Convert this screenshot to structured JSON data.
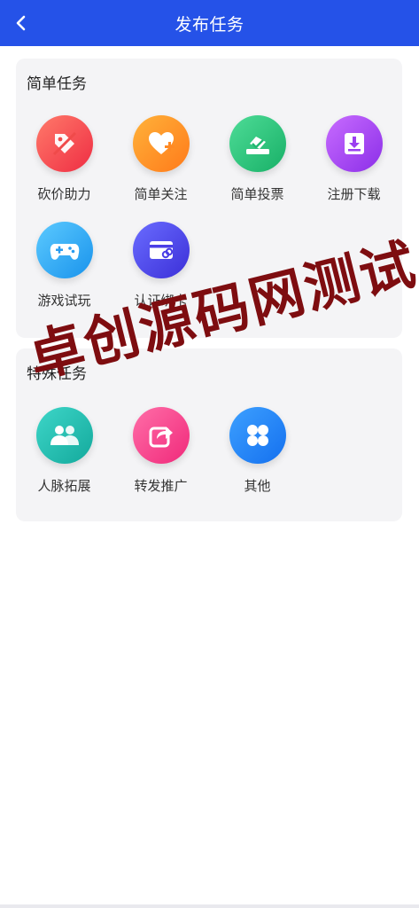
{
  "header": {
    "title": "发布任务",
    "back_icon": "chevron-left-icon",
    "background": "#2552e8"
  },
  "sections": [
    {
      "title": "简单任务",
      "items": [
        {
          "label": "砍价助力",
          "icon": "price-tag-slash-icon",
          "color_from": "#ff7a6a",
          "color_to": "#ef2d43"
        },
        {
          "label": "简单关注",
          "icon": "heart-plus-icon",
          "color_from": "#ffb23a",
          "color_to": "#ff7a1a"
        },
        {
          "label": "简单投票",
          "icon": "ballot-box-icon",
          "color_from": "#4edc97",
          "color_to": "#18b067"
        },
        {
          "label": "注册下载",
          "icon": "download-tray-icon",
          "color_from": "#c86cff",
          "color_to": "#8b2ee8"
        },
        {
          "label": "游戏试玩",
          "icon": "gamepad-icon",
          "color_from": "#5ccaff",
          "color_to": "#1993ec"
        },
        {
          "label": "认证绑卡",
          "icon": "card-link-icon",
          "color_from": "#6a6cff",
          "color_to": "#3b2fd8"
        }
      ]
    },
    {
      "title": "特殊任务",
      "items": [
        {
          "label": "人脉拓展",
          "icon": "users-icon",
          "color_from": "#3ed6c8",
          "color_to": "#13a99c"
        },
        {
          "label": "转发推广",
          "icon": "share-icon",
          "color_from": "#ff6ea8",
          "color_to": "#f0297a"
        },
        {
          "label": "其他",
          "icon": "four-leaf-icon",
          "color_from": "#3da0ff",
          "color_to": "#1470ef"
        }
      ]
    }
  ],
  "watermark": "卓创源码网测试"
}
